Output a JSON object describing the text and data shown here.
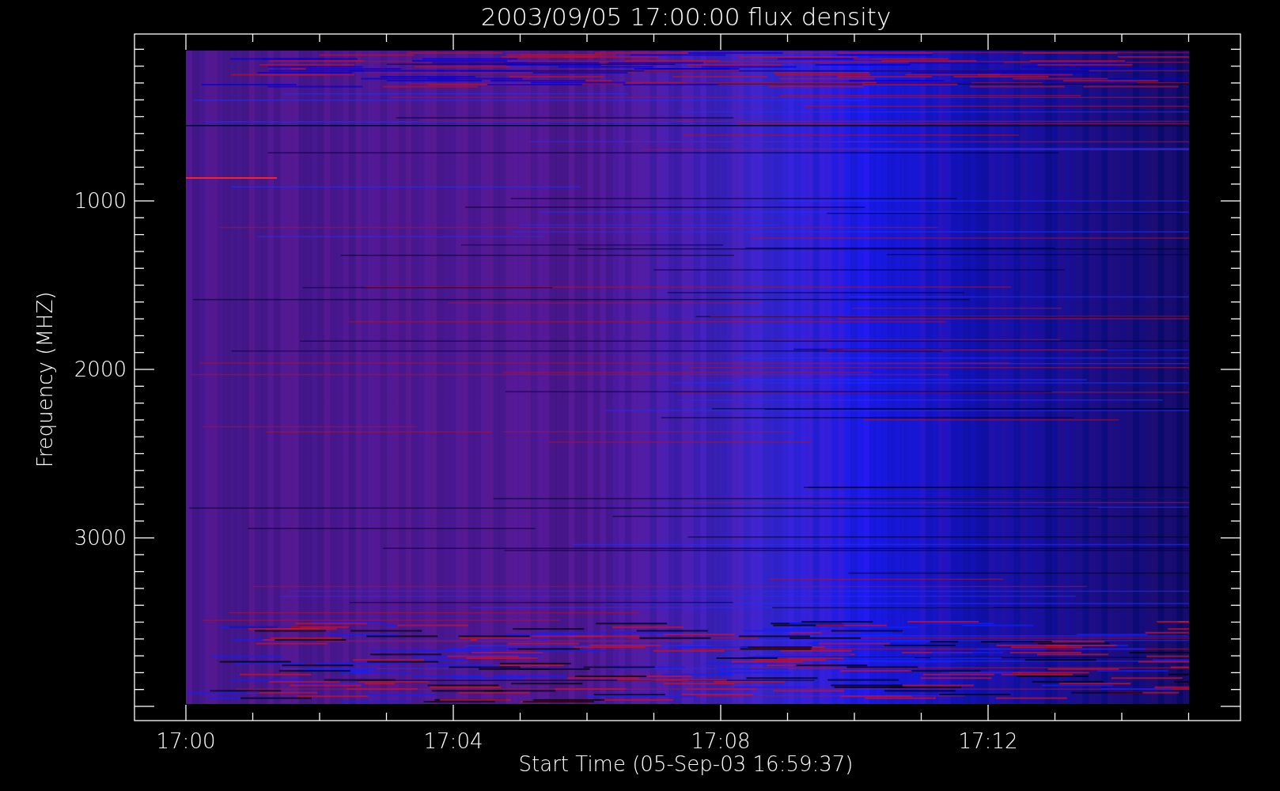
{
  "title": "2003/09/05 17:00:00 flux density",
  "x_axis": {
    "label": "Start Time (05-Sep-03 16:59:37)",
    "ticks": [
      "17:00",
      "17:04",
      "17:08",
      "17:12"
    ]
  },
  "y_axis": {
    "label": "Frequency (MHZ)",
    "ticks": [
      "1000",
      "2000",
      "3000"
    ]
  }
}
